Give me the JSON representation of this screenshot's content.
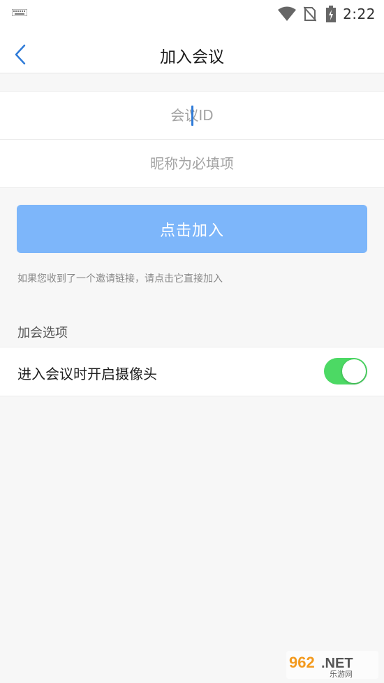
{
  "status_bar": {
    "time": "2:22",
    "icons": [
      "keyboard-icon",
      "wifi-icon",
      "no-sim-icon",
      "battery-charging-icon"
    ]
  },
  "nav": {
    "title": "加入会议",
    "back_icon": "back-arrow-icon"
  },
  "form": {
    "meeting_id": {
      "value": "",
      "placeholder": "会议ID"
    },
    "nickname": {
      "value": "",
      "placeholder": "昵称为必填项"
    }
  },
  "join_button": {
    "label": "点击加入"
  },
  "invite_hint": "如果您收到了一个邀请链接，请点击它直接加入",
  "options": {
    "header": "加会选项",
    "camera": {
      "label": "进入会议时开启摄像头",
      "enabled": true
    }
  },
  "watermark": {
    "text": "962.NET 乐游网"
  },
  "colors": {
    "accent": "#2f7bd8",
    "button": "#7db6fa",
    "toggle_on": "#4cd964",
    "background": "#f7f7f7"
  }
}
